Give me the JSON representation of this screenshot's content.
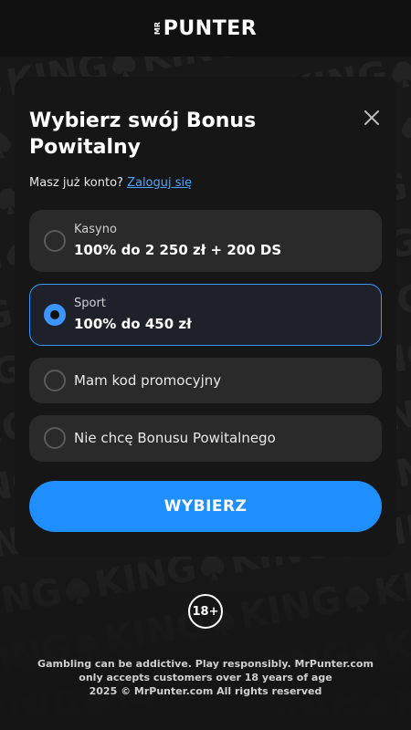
{
  "header": {
    "logo_prefix": "MR",
    "logo_word": "PUNTER"
  },
  "background": {
    "pattern_word": "KING"
  },
  "modal": {
    "title": "Wybierz swój Bonus Powitalny",
    "login_prompt": "Masz już konto?",
    "login_link": "Zaloguj się",
    "options": [
      {
        "sub": "Kasyno",
        "main": "100% do 2 250 zł + 200 DS",
        "selected": false
      },
      {
        "sub": "Sport",
        "main": "100% do 450 zł",
        "selected": true
      },
      {
        "label": "Mam kod promocyjny",
        "selected": false
      },
      {
        "label": "Nie chcę Bonusu Powitalnego",
        "selected": false
      }
    ],
    "submit_label": "WYBIERZ"
  },
  "footer": {
    "age_badge": "18+",
    "disclaimer": "Gambling can be addictive. Play responsibly. MrPunter.com only accepts customers over 18 years of age",
    "copyright": "2025 © MrPunter.com All rights reserved"
  },
  "colors": {
    "accent": "#1f8fff",
    "selected_border": "#3d95ff",
    "link": "#4ea4ff",
    "option_bg": "#2a2a2a",
    "modal_bg": "#161616"
  }
}
